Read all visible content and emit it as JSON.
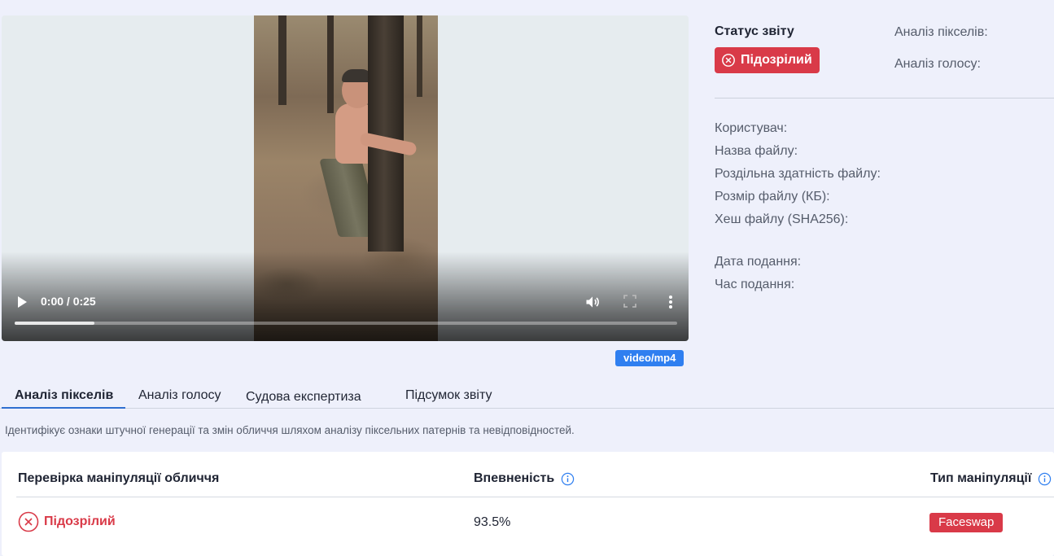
{
  "video": {
    "time": "0:00 / 0:25",
    "progress_fraction": 0.12,
    "mime_type": "video/mp4"
  },
  "report": {
    "status_title": "Статус звіту",
    "status_value": "Підозрілий",
    "pixel_analysis_label": "Аналіз пікселів:",
    "voice_analysis_label": "Аналіз голосу:"
  },
  "file_info": {
    "user_label": "Користувач:",
    "file_name_label": "Назва файлу:",
    "resolution_label": "Роздільна здатність файлу:",
    "size_label": "Розмір файлу (КБ):",
    "hash_label": "Хеш файлу (SHA256):",
    "date_label": "Дата подання:",
    "time_label": "Час подання:"
  },
  "tabs": [
    {
      "label": "Аналіз пікселів",
      "active": true
    },
    {
      "label": "Аналіз голосу",
      "active": false
    },
    {
      "label": "Судова експертиза",
      "active": false
    },
    {
      "label": "Підсумок звіту",
      "active": false
    }
  ],
  "description": "Ідентифікує ознаки штучної генерації та змін обличчя шляхом аналізу піксельних патернів та невідповідностей.",
  "results": {
    "col_check": "Перевірка маніпуляції обличчя",
    "col_confidence": "Впевненість",
    "col_type": "Тип маніпуляції",
    "row": {
      "status": "Підозрілий",
      "confidence": "93.5%",
      "type": "Faceswap"
    }
  },
  "colors": {
    "accent_blue": "#2f7ff0",
    "danger_red": "#d93a48",
    "background": "#eef0fb"
  }
}
